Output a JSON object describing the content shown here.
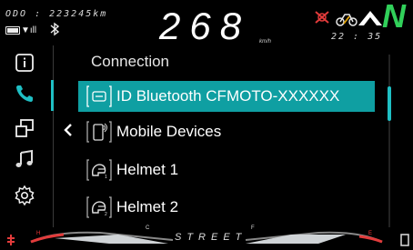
{
  "status": {
    "odometer": "ODO : 223245km",
    "speed": "268",
    "speed_unit": "km/h",
    "clock": "22 : 35",
    "gear": "N",
    "signal_glyph": "▼ıll",
    "icons": [
      "battery-icon",
      "signal-icon",
      "bluetooth-icon",
      "engine-warning-icon",
      "traction-warning-icon",
      "navigation-chevron-icon"
    ],
    "colors": {
      "gear": "#31d05a",
      "warning": "#e23b3b",
      "amber": "#e0a000",
      "accent": "#1fbfc4"
    }
  },
  "sidebar": {
    "items": [
      {
        "icon": "info-icon"
      },
      {
        "icon": "phone-icon",
        "active": true
      },
      {
        "icon": "screen-mirror-icon"
      },
      {
        "icon": "music-icon"
      },
      {
        "icon": "settings-icon"
      }
    ],
    "back_icon": "chevron-left-icon"
  },
  "content": {
    "title": "Connection",
    "items": [
      {
        "label": "ID Bluetooth CFMOTO-XXXXXX",
        "icon": "bluetooth-id-icon",
        "selected": true
      },
      {
        "label": "Mobile Devices",
        "icon": "mobile-device-icon"
      },
      {
        "label": "Helmet 1",
        "icon": "helmet-icon"
      },
      {
        "label": "Helmet 2",
        "icon": "helmet-icon"
      }
    ]
  },
  "gauges": {
    "mode": "STREET",
    "temp_low": "C",
    "temp_high": "H",
    "fuel_full": "F",
    "fuel_empty": "E"
  }
}
